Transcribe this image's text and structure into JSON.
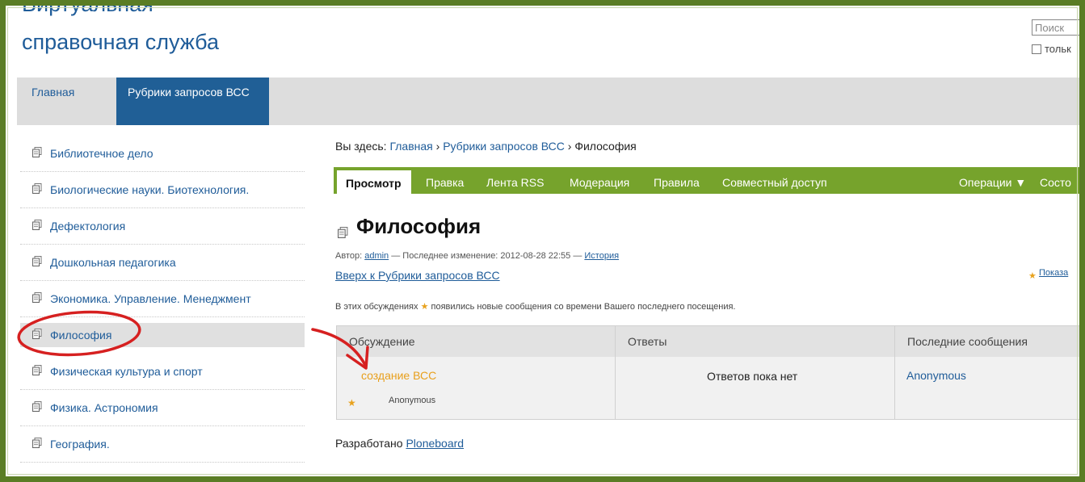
{
  "site": {
    "title_line1": "Виртуальная",
    "title_line2": "справочная служба"
  },
  "search": {
    "placeholder": "Поиск",
    "only_label": "тольк"
  },
  "nav": {
    "home": "Главная",
    "active": "Рубрики запросов ВСС"
  },
  "sidebar": {
    "items": [
      {
        "label": "Библиотечное дело"
      },
      {
        "label": "Биологические науки. Биотехнология."
      },
      {
        "label": "Дефектология"
      },
      {
        "label": "Дошкольная педагогика"
      },
      {
        "label": "Экономика. Управление. Менеджмент"
      },
      {
        "label": "Философия"
      },
      {
        "label": "Физическая культура и спорт"
      },
      {
        "label": "Физика. Астрономия"
      },
      {
        "label": "География."
      }
    ],
    "selected_index": 5
  },
  "breadcrumb": {
    "prefix": "Вы здесь:",
    "home": "Главная",
    "section": "Рубрики запросов ВСС",
    "current": "Философия",
    "sep": "›"
  },
  "tabs": {
    "view": "Просмотр",
    "edit": "Правка",
    "rss": "Лента RSS",
    "moderation": "Модерация",
    "rules": "Правила",
    "sharing": "Совместный доступ",
    "operations": "Операции ▼",
    "state": "Состо"
  },
  "page": {
    "title": "Философия",
    "byline_author_label": "Автор:",
    "byline_author": "admin",
    "byline_modified": "— Последнее изменение: 2012-08-28 22:55 —",
    "byline_history": "История",
    "up_link": "Вверх к Рубрики запросов ВСС",
    "show_link": "Показа",
    "notice_before": "В этих обсуждениях",
    "notice_after": "появились новые сообщения со времени Вашего последнего посещения."
  },
  "table": {
    "headers": {
      "discussion": "Обсуждение",
      "replies": "Ответы",
      "last": "Последние сообщения"
    },
    "rows": [
      {
        "topic": "создание ВСС",
        "author": "Anonymous",
        "replies": "Ответов пока нет",
        "last_author": "Anonymous"
      }
    ]
  },
  "footer": {
    "prefix": "Разработано",
    "link": "Ploneboard"
  },
  "colors": {
    "accent_green": "#76a32c",
    "nav_blue": "#205f96",
    "link_blue": "#1f5c99",
    "star_orange": "#e8a21e",
    "frame_green": "#5a7d25",
    "annotation_red": "#d62020"
  }
}
